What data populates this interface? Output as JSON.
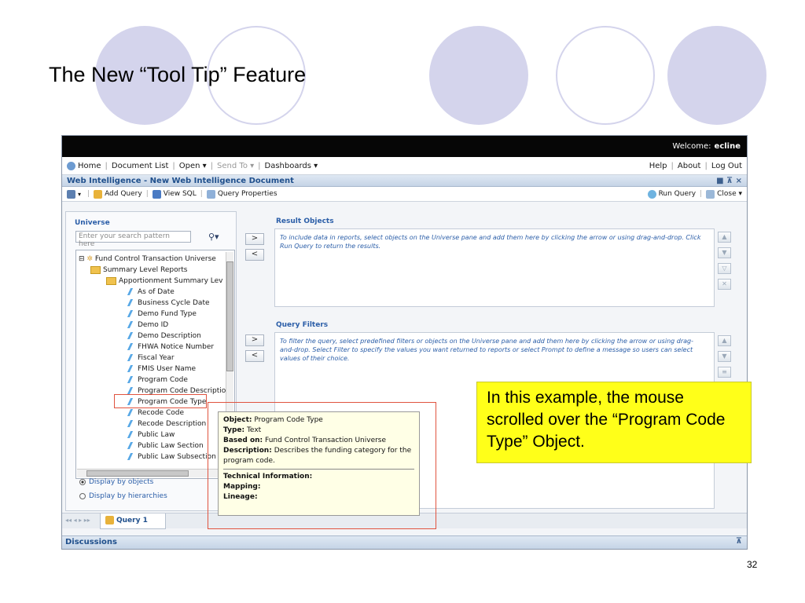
{
  "slide": {
    "title": "The New “Tool Tip” Feature",
    "page_number": "32"
  },
  "topbar": {
    "welcome_label": "Welcome:",
    "user": "ecline"
  },
  "menubar": {
    "left": [
      {
        "label": "Home",
        "enabled": true
      },
      {
        "label": "Document List",
        "enabled": true
      },
      {
        "label": "Open ▾",
        "enabled": true
      },
      {
        "label": "Send To ▾",
        "enabled": false
      },
      {
        "label": "Dashboards ▾",
        "enabled": true
      }
    ],
    "right": [
      "Help",
      "About",
      "Log Out"
    ]
  },
  "document": {
    "title": "Web Intelligence - New Web Intelligence Document",
    "window_controls": "■ ⊼ ×"
  },
  "toolbar": {
    "add_query": "Add Query",
    "view_sql": "View SQL",
    "query_properties": "Query Properties",
    "run_query": "Run Query",
    "close": "Close ▾"
  },
  "universe": {
    "header": "Universe",
    "search_placeholder": "Enter your search pattern here",
    "tree": [
      {
        "label": "Fund Control Transaction Universe",
        "kind": "root",
        "level": 0
      },
      {
        "label": "Summary Level Reports",
        "kind": "folder",
        "level": 1
      },
      {
        "label": "Apportionment Summary Lev",
        "kind": "folder",
        "level": 2
      },
      {
        "label": "As of Date",
        "kind": "leaf",
        "level": 3
      },
      {
        "label": "Business Cycle Date",
        "kind": "leaf",
        "level": 3
      },
      {
        "label": "Demo Fund Type",
        "kind": "leaf",
        "level": 3
      },
      {
        "label": "Demo ID",
        "kind": "leaf",
        "level": 3
      },
      {
        "label": "Demo Description",
        "kind": "leaf",
        "level": 3
      },
      {
        "label": "FHWA Notice Number",
        "kind": "leaf",
        "level": 3
      },
      {
        "label": "Fiscal Year",
        "kind": "leaf",
        "level": 3
      },
      {
        "label": "FMIS User Name",
        "kind": "leaf",
        "level": 3
      },
      {
        "label": "Program Code",
        "kind": "leaf",
        "level": 3
      },
      {
        "label": "Program Code Descriptio",
        "kind": "leaf",
        "level": 3
      },
      {
        "label": "Program Code Type",
        "kind": "leaf",
        "level": 3
      },
      {
        "label": "Recode Code",
        "kind": "leaf",
        "level": 3
      },
      {
        "label": "Recode Description",
        "kind": "leaf",
        "level": 3
      },
      {
        "label": "Public Law",
        "kind": "leaf",
        "level": 3
      },
      {
        "label": "Public Law Section",
        "kind": "leaf",
        "level": 3
      },
      {
        "label": "Public Law Subsection",
        "kind": "leaf",
        "level": 3
      }
    ],
    "display_by_objects": "Display by objects",
    "display_by_hierarchies": "Display by hierarchies"
  },
  "result_objects": {
    "header": "Result Objects",
    "hint": "To include data in reports, select objects on the Universe pane and add them here by clicking the arrow or using drag-and-drop. Click Run Query to return the results."
  },
  "query_filters": {
    "header": "Query Filters",
    "hint": "To filter the query, select predefined filters or objects on the Universe pane and add them here by clicking the arrow or using drag-and-drop. Select Filter to specify the values you want returned to reports or select Prompt to define a message so users can select values of their choice."
  },
  "tabs": {
    "nav": "◂◂ ◂ ▸ ▸▸",
    "query_tab": "Query 1"
  },
  "discussions": {
    "label": "Discussions",
    "control": "⊼"
  },
  "tooltip": {
    "object_label": "Object:",
    "object_value": "Program Code Type",
    "type_label": "Type:",
    "type_value": "Text",
    "based_on_label": "Based on:",
    "based_on_value": "Fund Control Transaction Universe",
    "description_label": "Description:",
    "description_value": "Describes the funding category for the program code.",
    "technical": "Technical Information:",
    "mapping": "Mapping:",
    "lineage": "Lineage:"
  },
  "callout": {
    "text": "In this example, the mouse scrolled over the “Program Code Type” Object."
  },
  "buttons": {
    "add": ">",
    "remove": "<"
  }
}
